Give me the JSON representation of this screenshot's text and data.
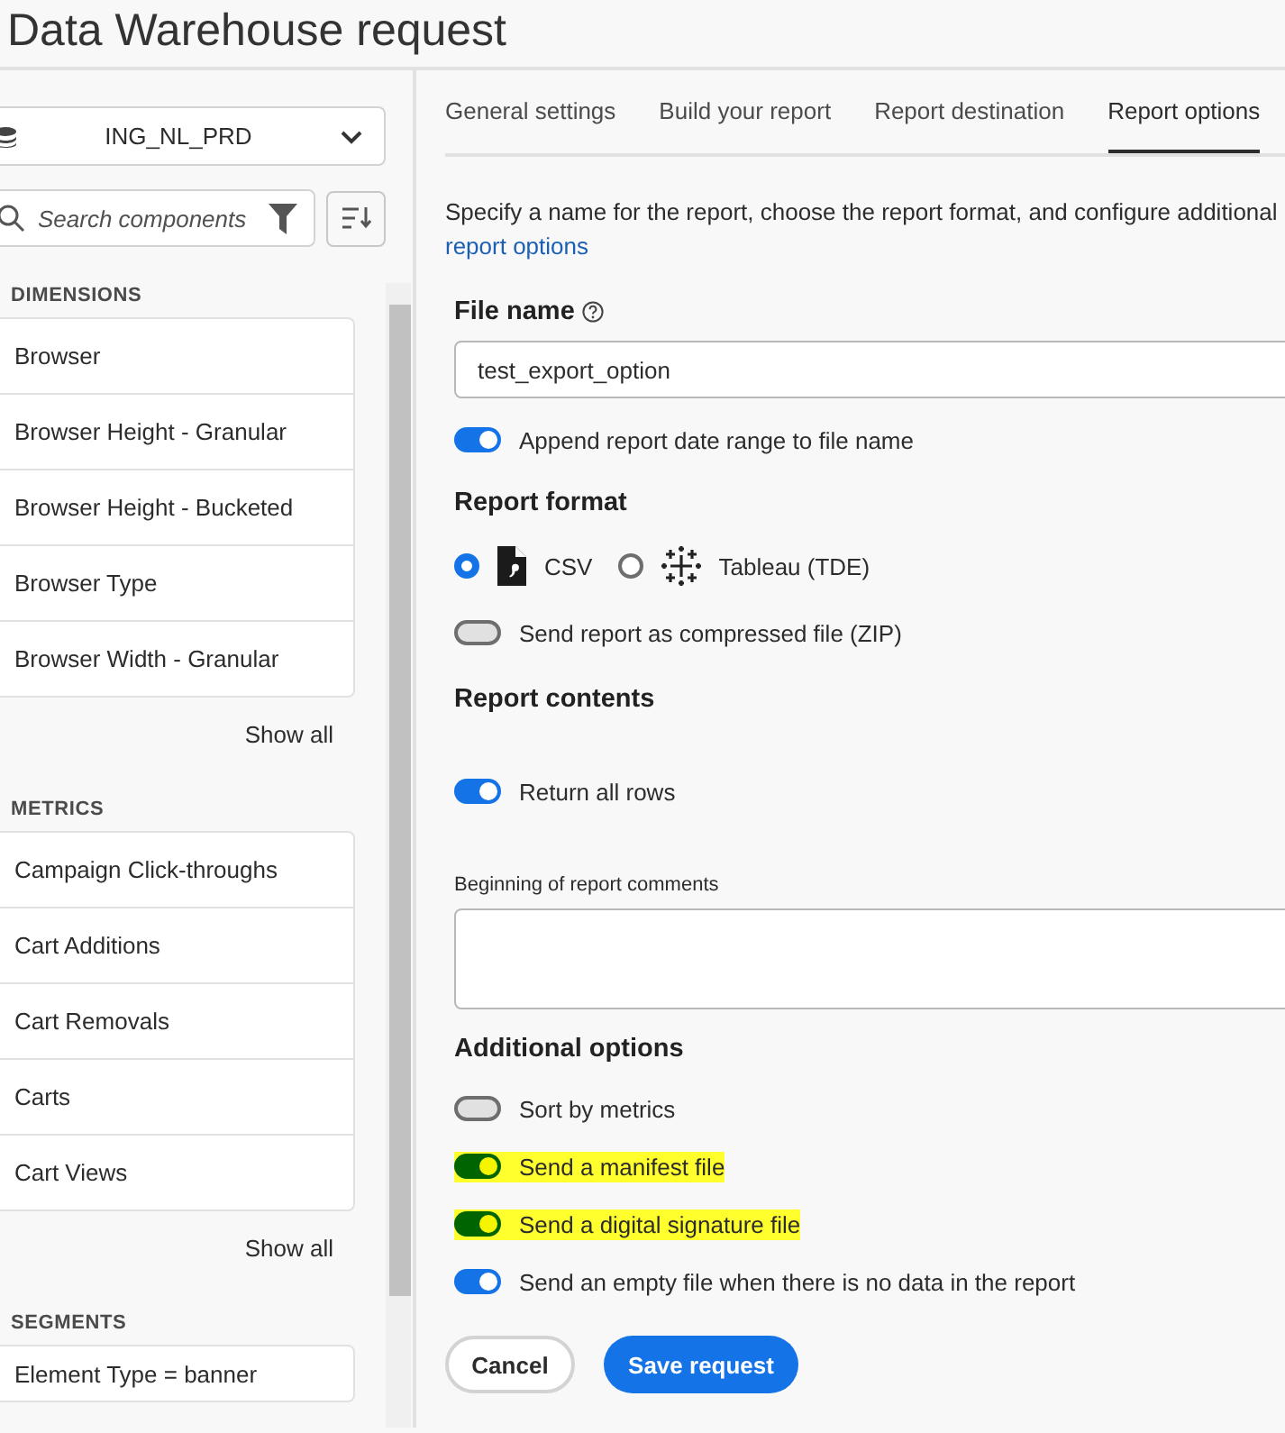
{
  "window": {
    "title": "Data Warehouse request"
  },
  "sidebar": {
    "data_source": "ING_NL_PRD",
    "search": {
      "placeholder": "Search components"
    },
    "sections": [
      {
        "title": "DIMENSIONS",
        "items": [
          "Browser",
          "Browser Height - Granular",
          "Browser Height - Bucketed",
          "Browser Type",
          "Browser Width - Granular"
        ],
        "show_all": "Show all"
      },
      {
        "title": "METRICS",
        "items": [
          "Campaign Click-throughs",
          "Cart Additions",
          "Cart Removals",
          "Carts",
          "Cart Views"
        ],
        "show_all": "Show all"
      },
      {
        "title": "SEGMENTS",
        "items": [
          "Element Type = banner"
        ]
      }
    ]
  },
  "tabs": [
    {
      "label": "General settings",
      "selected": false
    },
    {
      "label": "Build your report",
      "selected": false
    },
    {
      "label": "Report destination",
      "selected": false
    },
    {
      "label": "Report options",
      "selected": true
    }
  ],
  "main": {
    "description": "Specify a name for the report, choose the report format, and configure additional",
    "link": "report options",
    "file_name": {
      "label": "File name",
      "value": "test_export_option"
    },
    "append_date": {
      "label": "Append report date range to file name",
      "on": true
    },
    "format_heading": "Report format",
    "formats": [
      {
        "label": "CSV",
        "kind": "csv",
        "selected": true
      },
      {
        "label": "Tableau (TDE)",
        "kind": "tableau",
        "selected": false
      }
    ],
    "zip": {
      "label": "Send report as compressed file (ZIP)",
      "on": false
    },
    "contents_heading": "Report contents",
    "return_all_rows": {
      "label": "Return all rows",
      "on": true
    },
    "comments_label": "Beginning of report comments",
    "additional_heading": "Additional options",
    "additional": [
      {
        "label": "Sort by metrics",
        "on": false,
        "highlighted": false
      },
      {
        "label": "Send a manifest file",
        "on": true,
        "highlighted": true
      },
      {
        "label": "Send a digital signature file",
        "on": true,
        "highlighted": true
      },
      {
        "label": "Send an empty file when there is no data in the report",
        "on": true,
        "highlighted": false
      }
    ],
    "buttons": [
      {
        "label": "Cancel",
        "kind": "secondary"
      },
      {
        "label": "Save request",
        "kind": "primary"
      }
    ]
  }
}
